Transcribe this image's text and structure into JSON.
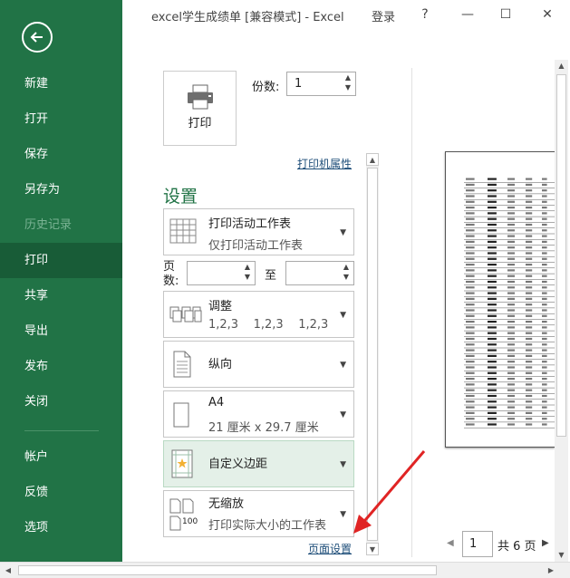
{
  "window": {
    "title": "excel学生成绩单 [兼容模式] - Excel",
    "login": "登录",
    "help": "?",
    "minimize": "—",
    "maximize": "☐",
    "close": "✕"
  },
  "sidebar": {
    "back_icon": "back-arrow-icon",
    "items": [
      {
        "label": "新建",
        "state": "normal"
      },
      {
        "label": "打开",
        "state": "normal"
      },
      {
        "label": "保存",
        "state": "normal"
      },
      {
        "label": "另存为",
        "state": "normal"
      },
      {
        "label": "历史记录",
        "state": "disabled"
      },
      {
        "label": "打印",
        "state": "active"
      },
      {
        "label": "共享",
        "state": "normal"
      },
      {
        "label": "导出",
        "state": "normal"
      },
      {
        "label": "发布",
        "state": "normal"
      },
      {
        "label": "关闭",
        "state": "normal"
      },
      {
        "label": "帐户",
        "state": "normal"
      },
      {
        "label": "反馈",
        "state": "normal"
      },
      {
        "label": "选项",
        "state": "normal"
      }
    ],
    "colors": {
      "bg": "#217346",
      "active": "#185c37"
    }
  },
  "print": {
    "print_button": "打印",
    "copies_label": "份数:",
    "copies_value": "1",
    "printer_properties": "打印机属性"
  },
  "settings": {
    "title": "设置",
    "what": {
      "line1": "打印活动工作表",
      "line2": "仅打印活动工作表"
    },
    "pages_label": "页数:",
    "pages_from": "",
    "pages_to_label": "至",
    "pages_to": "",
    "collate": {
      "line1": "调整",
      "line2": "1,2,3    1,2,3    1,2,3"
    },
    "orientation": {
      "line1": "纵向"
    },
    "paper": {
      "line1": "A4",
      "line2": "21 厘米 x 29.7 厘米"
    },
    "margins": {
      "line1": "自定义边距"
    },
    "scaling": {
      "line1": "无缩放",
      "line2": "打印实际大小的工作表",
      "icon_number": "100"
    },
    "page_setup": "页面设置"
  },
  "preview": {
    "page_current": "1",
    "page_total_label": "共 6 页"
  }
}
